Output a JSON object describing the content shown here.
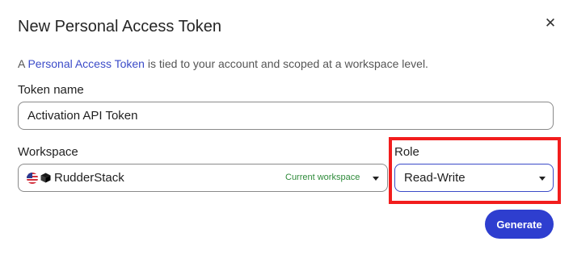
{
  "dialog": {
    "title": "New Personal Access Token",
    "close_icon": "close-icon",
    "description_prefix": "A ",
    "description_link": "Personal Access Token",
    "description_suffix": " is tied to your account and scoped at a workspace level."
  },
  "token_name": {
    "label": "Token name",
    "value": "Activation API Token"
  },
  "workspace": {
    "label": "Workspace",
    "value": "RudderStack",
    "tag": "Current workspace",
    "icons": [
      "us-flag-icon",
      "cube-icon",
      "chevron-down-icon"
    ]
  },
  "role": {
    "label": "Role",
    "value": "Read-Write",
    "icon": "chevron-down-icon"
  },
  "actions": {
    "generate_label": "Generate"
  },
  "colors": {
    "primary": "#2e3ecf",
    "link": "#3b4bc8",
    "current_tag": "#2e8b3a",
    "highlight": "#f21d1d"
  }
}
